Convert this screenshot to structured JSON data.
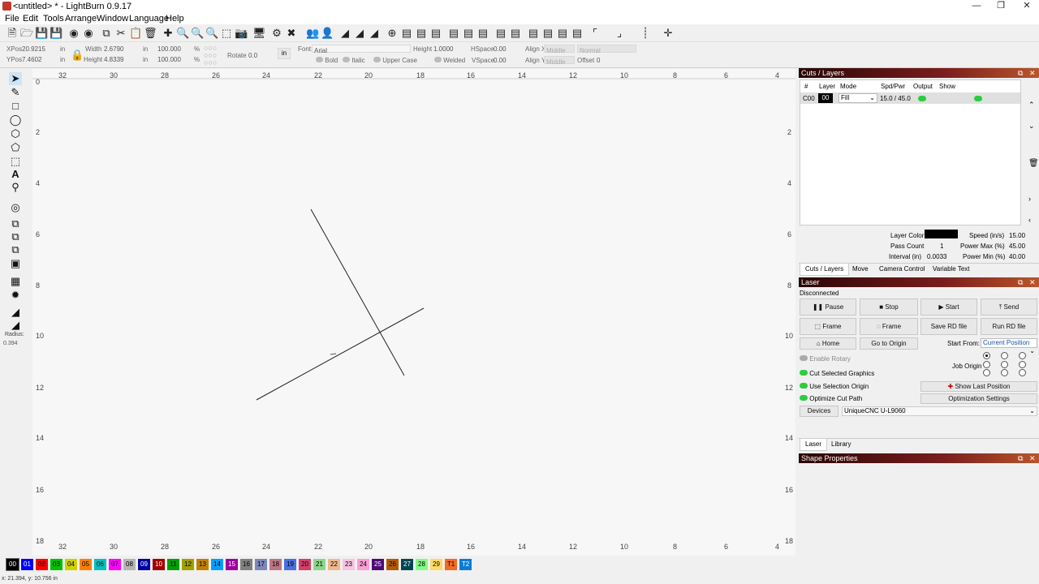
{
  "window": {
    "title": "<untitled> * - LightBurn 0.9.17"
  },
  "menu": [
    "File",
    "Edit",
    "Tools",
    "Arrange",
    "Window",
    "Language",
    "Help"
  ],
  "props": {
    "xpos_label": "XPos",
    "xpos": "20.9215",
    "ypos_label": "YPos",
    "ypos": "7.4602",
    "unit": "in",
    "width_label": "Width",
    "width": "2.6790",
    "height_label": "Height",
    "height": "4.8339",
    "scale_w": "100.000",
    "scale_h": "100.000",
    "pct": "%",
    "rotate_label": "Rotate",
    "rotate": "0.0",
    "in_btn": "in",
    "font_label": "Font:",
    "font": "Arial",
    "fheight_label": "Height",
    "fheight": "1.0000",
    "hspace_label": "HSpace",
    "hspace": "0.00",
    "vspace_label": "VSpace",
    "vspace": "0.00",
    "alignx_label": "Align X",
    "alignx": "Middle",
    "aligny_label": "Align Y",
    "aligny": "Middle",
    "normal": "Normal",
    "offset_label": "Offset",
    "offset": "0",
    "bold": "Bold",
    "italic": "Italic",
    "upper": "Upper Case",
    "welded": "Welded"
  },
  "left": {
    "radius_label": "Radius:",
    "radius": "0.394"
  },
  "ruler": {
    "top": [
      "32",
      "30",
      "28",
      "26",
      "24",
      "22",
      "20",
      "18",
      "16",
      "14",
      "12",
      "10",
      "8",
      "6",
      "4"
    ],
    "side": [
      "0",
      "2",
      "4",
      "6",
      "8",
      "10",
      "12",
      "14",
      "16",
      "18"
    ]
  },
  "cuts": {
    "title": "Cuts / Layers",
    "headers": [
      "#",
      "Layer",
      "Mode",
      "Spd/Pwr",
      "Output",
      "Show"
    ],
    "row": {
      "num": "C00",
      "layer": "00",
      "mode": "Fill",
      "spdpwr": "15.0 / 45.0"
    },
    "layer_color_label": "Layer Color",
    "speed_label": "Speed (in/s)",
    "speed": "15.00",
    "pass_label": "Pass Count",
    "pass": "1",
    "pmax_label": "Power Max (%)",
    "pmax": "45.00",
    "interval_label": "Interval (in)",
    "interval": "0.0033",
    "pmin_label": "Power Min (%)",
    "pmin": "40.00",
    "tabs": [
      "Cuts / Layers",
      "Move",
      "Camera Control",
      "Variable Text"
    ]
  },
  "laser": {
    "title": "Laser",
    "status": "Disconnected",
    "btn_pause": "Pause",
    "btn_stop": "Stop",
    "btn_start": "Start",
    "btn_send": "Send",
    "btn_frame1": "Frame",
    "btn_frame2": "Frame",
    "btn_saverd": "Save RD file",
    "btn_runrd": "Run RD file",
    "btn_home": "Home",
    "btn_goto": "Go to Origin",
    "start_from_label": "Start From:",
    "start_from": "Current Position",
    "enable_rotary": "Enable Rotary",
    "job_origin": "Job Origin",
    "cut_selected": "Cut Selected Graphics",
    "use_sel_origin": "Use Selection Origin",
    "optimize_path": "Optimize Cut Path",
    "show_last": "Show Last Position",
    "opt_settings": "Optimization Settings",
    "devices_btn": "Devices",
    "device": "UniqueCNC U-L9060",
    "tabs": [
      "Laser",
      "Library"
    ]
  },
  "shape": {
    "title": "Shape Properties"
  },
  "palette": [
    {
      "label": "00",
      "color": "#000000",
      "fg": "#ffffff"
    },
    {
      "label": "01",
      "color": "#0000ff",
      "fg": "#ffffff"
    },
    {
      "label": "02",
      "color": "#ff0000",
      "fg": "#000000"
    },
    {
      "label": "03",
      "color": "#00c000",
      "fg": "#000000"
    },
    {
      "label": "04",
      "color": "#d0d000",
      "fg": "#000000"
    },
    {
      "label": "05",
      "color": "#ff8000",
      "fg": "#000000"
    },
    {
      "label": "06",
      "color": "#00c0c0",
      "fg": "#000000"
    },
    {
      "label": "07",
      "color": "#ff00ff",
      "fg": "#000000"
    },
    {
      "label": "08",
      "color": "#b4b4b4",
      "fg": "#000000"
    },
    {
      "label": "09",
      "color": "#0000a0",
      "fg": "#ffffff"
    },
    {
      "label": "10",
      "color": "#a00000",
      "fg": "#ffffff"
    },
    {
      "label": "11",
      "color": "#00a000",
      "fg": "#000000"
    },
    {
      "label": "12",
      "color": "#a0a000",
      "fg": "#000000"
    },
    {
      "label": "13",
      "color": "#c08000",
      "fg": "#000000"
    },
    {
      "label": "14",
      "color": "#00a0ff",
      "fg": "#000000"
    },
    {
      "label": "15",
      "color": "#a000a0",
      "fg": "#ffffff"
    },
    {
      "label": "16",
      "color": "#808080",
      "fg": "#000000"
    },
    {
      "label": "17",
      "color": "#7d87b9",
      "fg": "#000000"
    },
    {
      "label": "18",
      "color": "#bb7784",
      "fg": "#000000"
    },
    {
      "label": "19",
      "color": "#4a6fe3",
      "fg": "#000000"
    },
    {
      "label": "20",
      "color": "#d33f6a",
      "fg": "#000000"
    },
    {
      "label": "21",
      "color": "#8cd78c",
      "fg": "#000000"
    },
    {
      "label": "22",
      "color": "#f0b98d",
      "fg": "#000000"
    },
    {
      "label": "23",
      "color": "#f6c4e1",
      "fg": "#000000"
    },
    {
      "label": "24",
      "color": "#fa9ed4",
      "fg": "#000000"
    },
    {
      "label": "25",
      "color": "#500a78",
      "fg": "#ffffff"
    },
    {
      "label": "26",
      "color": "#b45a00",
      "fg": "#000000"
    },
    {
      "label": "27",
      "color": "#004754",
      "fg": "#ffffff"
    },
    {
      "label": "28",
      "color": "#86fa88",
      "fg": "#000000"
    },
    {
      "label": "29",
      "color": "#ffdb66",
      "fg": "#000000"
    },
    {
      "label": "T1",
      "color": "#f36926",
      "fg": "#000000"
    },
    {
      "label": "T2",
      "color": "#0c7cd5",
      "fg": "#ffffff"
    }
  ],
  "status": "x: 21.394, y: 10.756 in"
}
